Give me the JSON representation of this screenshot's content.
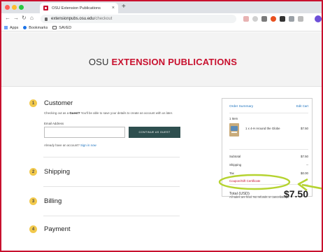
{
  "browser": {
    "tab_title": "OSU Extension Publications",
    "tab_close": "×",
    "new_tab": "+",
    "url_host": "extensionpubs.osu.edu",
    "url_path": "/checkout",
    "bookmarks": [
      "Apps",
      "Bookmarks",
      "SAVED"
    ]
  },
  "site": {
    "title_prefix": "OSU ",
    "title_brand": "EXTENSION PUBLICATIONS"
  },
  "steps": [
    {
      "number": "1",
      "label": "Customer"
    },
    {
      "number": "2",
      "label": "Shipping"
    },
    {
      "number": "3",
      "label": "Billing"
    },
    {
      "number": "4",
      "label": "Payment"
    }
  ],
  "customer": {
    "guest_prefix": "Checking out as a ",
    "guest_bold": "Guest?",
    "guest_suffix": " You'll be able to save your details to create an account with us later.",
    "email_label": "Email Address",
    "email_value": "",
    "continue_button": "CONTINUE AS GUEST",
    "account_prefix": "Already have an account? ",
    "sign_in_link": "Sign in now"
  },
  "summary": {
    "title": "Order Summary",
    "edit_cart": "Edit Cart",
    "item_count": "1 Item",
    "item_name": "1 x 4-H Around the Globe",
    "item_price": "$7.50",
    "subtotal_label": "Subtotal",
    "subtotal_value": "$7.50",
    "shipping_label": "Shipping",
    "shipping_value": "--",
    "tax_label": "Tax",
    "tax_value": "$0.00",
    "coupon_link": "Coupon/Gift Certificate",
    "total_label": "Total (USD)",
    "total_value": "$7.50",
    "final_note": "All sales are final. No refunds or cancellations."
  },
  "colors": {
    "brand_red": "#c8102e",
    "step_badge": "#f2c94c",
    "button": "#2e4f4f",
    "link": "#1e73be",
    "annotation": "#b5d330"
  }
}
